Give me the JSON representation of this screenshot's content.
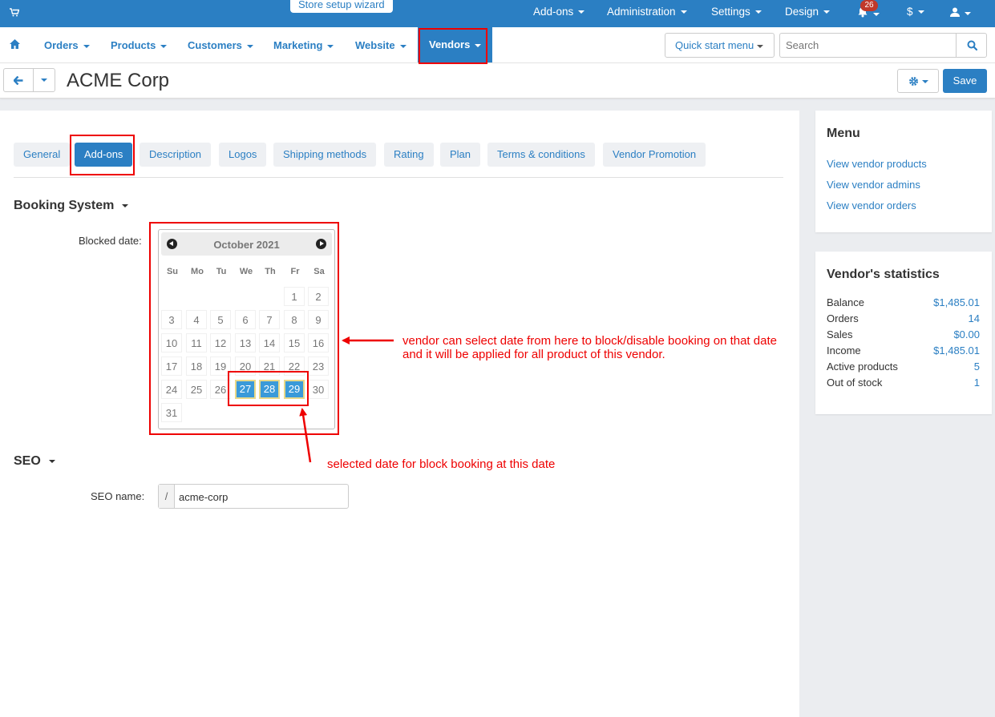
{
  "topbar": {
    "wizard_label": "Store setup wizard",
    "menus": [
      "Add-ons",
      "Administration",
      "Settings",
      "Design"
    ],
    "notifications_count": "26",
    "currency_label": "$"
  },
  "navbar": {
    "items": [
      "Orders",
      "Products",
      "Customers",
      "Marketing",
      "Website",
      "Vendors"
    ],
    "quick_start_label": "Quick start menu",
    "search_placeholder": "Search"
  },
  "page": {
    "title": "ACME Corp",
    "save_label": "Save"
  },
  "tabs": [
    "General",
    "Add-ons",
    "Description",
    "Logos",
    "Shipping methods",
    "Rating",
    "Plan",
    "Terms & conditions",
    "Vendor Promotion"
  ],
  "booking": {
    "section_title": "Booking System",
    "blocked_date_label": "Blocked date:",
    "calendar": {
      "month_label": "October 2021",
      "weekdays": [
        "Su",
        "Mo",
        "Tu",
        "We",
        "Th",
        "Fr",
        "Sa"
      ],
      "first_weekday_index": 5,
      "days_in_month": 31,
      "selected_days": [
        27,
        28,
        29
      ]
    }
  },
  "seo": {
    "section_title": "SEO",
    "name_label": "SEO name:",
    "prefix": "/",
    "value": "acme-corp"
  },
  "sidebar": {
    "menu_title": "Menu",
    "menu_links": [
      "View vendor products",
      "View vendor admins",
      "View vendor orders"
    ],
    "stats_title": "Vendor's statistics",
    "stats": [
      {
        "label": "Balance",
        "value": "$1,485.01"
      },
      {
        "label": "Orders",
        "value": "14"
      },
      {
        "label": "Sales",
        "value": "$0.00"
      },
      {
        "label": "Income",
        "value": "$1,485.01"
      },
      {
        "label": "Active products",
        "value": "5"
      },
      {
        "label": "Out of stock",
        "value": "1"
      }
    ]
  },
  "annotations": {
    "calendar_note_line1": "vendor can select date from here to block/disable booking on that date",
    "calendar_note_line2": "and it will be applied for all product of this vendor.",
    "selected_note": "selected date for block booking at this date",
    "color": "#ee0000"
  },
  "colors": {
    "accent": "#2b7fc3",
    "selected_day": "#3a9ad9",
    "badge": "#c0392b"
  }
}
